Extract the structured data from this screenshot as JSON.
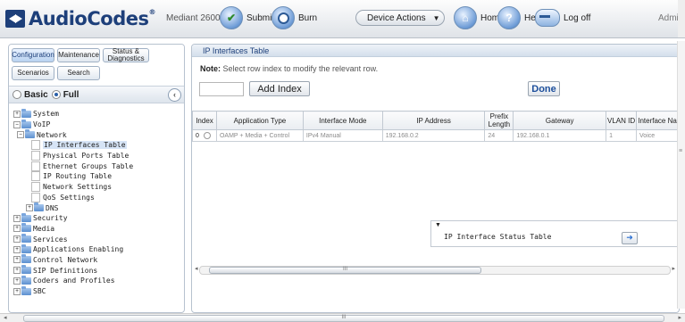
{
  "header": {
    "logo_text": "AudioCodes",
    "logo_reg": "®",
    "device_name": "Mediant 2600",
    "submit_label": "Submit",
    "burn_label": "Burn",
    "device_actions_label": "Device Actions",
    "home_label": "Home",
    "help_label": "Help",
    "logoff_label": "Log off",
    "user_label": "Admi"
  },
  "left_panel": {
    "tabs": {
      "configuration": "Configuration",
      "maintenance": "Maintenance",
      "status": "Status & Diagnostics",
      "scenarios": "Scenarios",
      "search": "Search"
    },
    "mode": {
      "basic": "Basic",
      "full": "Full",
      "selected": "Full"
    },
    "collapse_icon": "chevron-left-icon",
    "tree": {
      "system": "System",
      "voip": "VoIP",
      "network": "Network",
      "ip_interfaces": "IP Interfaces Table",
      "physical_ports": "Physical Ports Table",
      "ethernet_groups": "Ethernet Groups Table",
      "ip_routing": "IP Routing Table",
      "network_settings": "Network Settings",
      "qos": "QoS Settings",
      "dns": "DNS",
      "security": "Security",
      "media": "Media",
      "services": "Services",
      "applications": "Applications Enabling",
      "control_network": "Control Network",
      "sip_definitions": "SIP Definitions",
      "coders_profiles": "Coders and Profiles",
      "sbc": "SBC"
    }
  },
  "main": {
    "page_title": "IP Interfaces Table",
    "note_label": "Note:",
    "note_text": " Select row index to modify the relevant row.",
    "add_index_label": "Add Index",
    "done_label": "Done",
    "columns": {
      "index": "Index",
      "app_type": "Application Type",
      "iface_mode": "Interface Mode",
      "ip": "IP Address",
      "prefix": "Prefix Length",
      "gateway": "Gateway",
      "vlan": "VLAN ID",
      "iface_name": "Interface Na"
    },
    "rows": [
      {
        "index": "0",
        "app_type": "OAMP + Media + Control",
        "iface_mode": "IPv4 Manual",
        "ip": "192.168.0.2",
        "prefix": "24",
        "gateway": "192.168.0.1",
        "vlan": "1",
        "iface_name": "Voice"
      }
    ],
    "status_table_label": "IP Interface Status Table",
    "scroll_grip": "III"
  }
}
